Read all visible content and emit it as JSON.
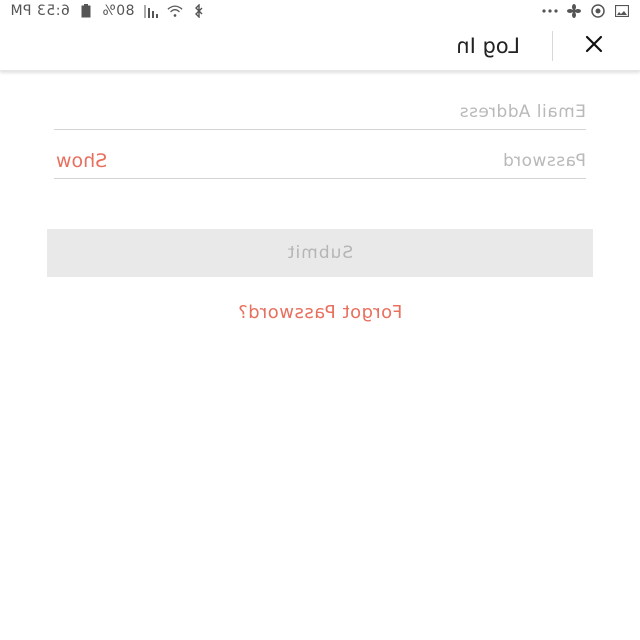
{
  "status_bar": {
    "time": "6:53 PM",
    "battery_percent": "80%",
    "icons_left": [
      "battery-icon",
      "signal-icon",
      "wifi-icon",
      "bluetooth-icon"
    ],
    "icons_right": [
      "more-dots-icon",
      "fan-icon",
      "circle-status-icon",
      "image-icon"
    ]
  },
  "header": {
    "title": "Log In",
    "close_icon": "close-icon"
  },
  "form": {
    "email_placeholder": "Email Address",
    "email_value": "",
    "password_placeholder": "Password",
    "password_value": "",
    "show_label": "Show",
    "submit_label": "Submit",
    "forgot_label": "Forgot Password?"
  },
  "colors": {
    "accent": "#e8705f",
    "submit_bg": "#e9e9e9",
    "submit_text": "#b5b5b5",
    "placeholder": "#b9b9b9"
  }
}
